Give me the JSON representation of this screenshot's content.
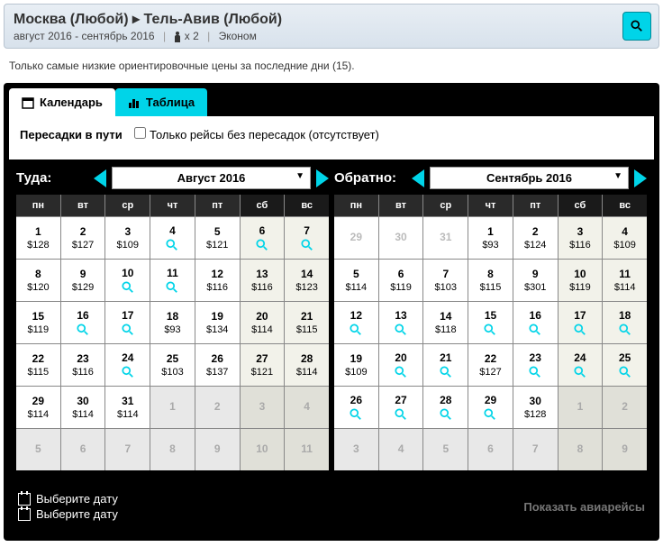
{
  "header": {
    "from": "Москва (Любой)",
    "arrow": "▸",
    "to": "Тель-Авив (Любой)",
    "dates": "август 2016 - сентябрь 2016",
    "pax": "x 2",
    "class": "Эконом"
  },
  "notice": "Только самые низкие ориентировочные цены за последние дни (15).",
  "tabs": {
    "calendar": "Календарь",
    "table": "Таблица"
  },
  "filter": {
    "label": "Пересадки в пути",
    "checkbox": "Только рейсы без пересадок (отсутствует)"
  },
  "outbound": {
    "label": "Туда:",
    "month": "Август 2016",
    "dow": [
      "пн",
      "вт",
      "ср",
      "чт",
      "пт",
      "сб",
      "вс"
    ],
    "cells": [
      {
        "d": "1",
        "p": "$128"
      },
      {
        "d": "2",
        "p": "$127"
      },
      {
        "d": "3",
        "p": "$109"
      },
      {
        "d": "4",
        "s": true
      },
      {
        "d": "5",
        "p": "$121"
      },
      {
        "d": "6",
        "s": true,
        "w": true
      },
      {
        "d": "7",
        "s": true,
        "w": true
      },
      {
        "d": "8",
        "p": "$120"
      },
      {
        "d": "9",
        "p": "$129"
      },
      {
        "d": "10",
        "s": true
      },
      {
        "d": "11",
        "s": true
      },
      {
        "d": "12",
        "p": "$116"
      },
      {
        "d": "13",
        "p": "$116",
        "w": true
      },
      {
        "d": "14",
        "p": "$123",
        "w": true
      },
      {
        "d": "15",
        "p": "$119"
      },
      {
        "d": "16",
        "s": true
      },
      {
        "d": "17",
        "s": true
      },
      {
        "d": "18",
        "p": "$93"
      },
      {
        "d": "19",
        "p": "$134"
      },
      {
        "d": "20",
        "p": "$114",
        "w": true
      },
      {
        "d": "21",
        "p": "$115",
        "w": true
      },
      {
        "d": "22",
        "p": "$115"
      },
      {
        "d": "23",
        "p": "$116"
      },
      {
        "d": "24",
        "s": true
      },
      {
        "d": "25",
        "p": "$103"
      },
      {
        "d": "26",
        "p": "$137"
      },
      {
        "d": "27",
        "p": "$121",
        "w": true
      },
      {
        "d": "28",
        "p": "$114",
        "w": true
      },
      {
        "d": "29",
        "p": "$114"
      },
      {
        "d": "30",
        "p": "$114"
      },
      {
        "d": "31",
        "p": "$114"
      },
      {
        "d": "1",
        "dis": true
      },
      {
        "d": "2",
        "dis": true
      },
      {
        "d": "3",
        "dis": true,
        "w": true
      },
      {
        "d": "4",
        "dis": true,
        "w": true
      },
      {
        "d": "5",
        "dis": true
      },
      {
        "d": "6",
        "dis": true
      },
      {
        "d": "7",
        "dis": true
      },
      {
        "d": "8",
        "dis": true
      },
      {
        "d": "9",
        "dis": true
      },
      {
        "d": "10",
        "dis": true,
        "w": true
      },
      {
        "d": "11",
        "dis": true,
        "w": true
      }
    ]
  },
  "return": {
    "label": "Обратно:",
    "month": "Сентябрь 2016",
    "dow": [
      "пн",
      "вт",
      "ср",
      "чт",
      "пт",
      "сб",
      "вс"
    ],
    "cells": [
      {
        "d": "29",
        "prev": true
      },
      {
        "d": "30",
        "prev": true
      },
      {
        "d": "31",
        "prev": true
      },
      {
        "d": "1",
        "p": "$93"
      },
      {
        "d": "2",
        "p": "$124"
      },
      {
        "d": "3",
        "p": "$116",
        "w": true
      },
      {
        "d": "4",
        "p": "$109",
        "w": true
      },
      {
        "d": "5",
        "p": "$114"
      },
      {
        "d": "6",
        "p": "$119"
      },
      {
        "d": "7",
        "p": "$103"
      },
      {
        "d": "8",
        "p": "$115"
      },
      {
        "d": "9",
        "p": "$301"
      },
      {
        "d": "10",
        "p": "$119",
        "w": true
      },
      {
        "d": "11",
        "p": "$114",
        "w": true
      },
      {
        "d": "12",
        "s": true
      },
      {
        "d": "13",
        "s": true
      },
      {
        "d": "14",
        "p": "$118"
      },
      {
        "d": "15",
        "s": true
      },
      {
        "d": "16",
        "s": true
      },
      {
        "d": "17",
        "s": true,
        "w": true
      },
      {
        "d": "18",
        "s": true,
        "w": true
      },
      {
        "d": "19",
        "p": "$109"
      },
      {
        "d": "20",
        "s": true
      },
      {
        "d": "21",
        "s": true
      },
      {
        "d": "22",
        "p": "$127"
      },
      {
        "d": "23",
        "s": true
      },
      {
        "d": "24",
        "s": true,
        "w": true
      },
      {
        "d": "25",
        "s": true,
        "w": true
      },
      {
        "d": "26",
        "s": true
      },
      {
        "d": "27",
        "s": true
      },
      {
        "d": "28",
        "s": true
      },
      {
        "d": "29",
        "s": true
      },
      {
        "d": "30",
        "p": "$128"
      },
      {
        "d": "1",
        "dis": true,
        "w": true
      },
      {
        "d": "2",
        "dis": true,
        "w": true
      },
      {
        "d": "3",
        "dis": true
      },
      {
        "d": "4",
        "dis": true
      },
      {
        "d": "5",
        "dis": true
      },
      {
        "d": "6",
        "dis": true
      },
      {
        "d": "7",
        "dis": true
      },
      {
        "d": "8",
        "dis": true,
        "w": true
      },
      {
        "d": "9",
        "dis": true,
        "w": true
      }
    ]
  },
  "footer": {
    "pick1": "Выберите дату",
    "pick2": "Выберите дату",
    "show": "Показать авиарейсы"
  }
}
